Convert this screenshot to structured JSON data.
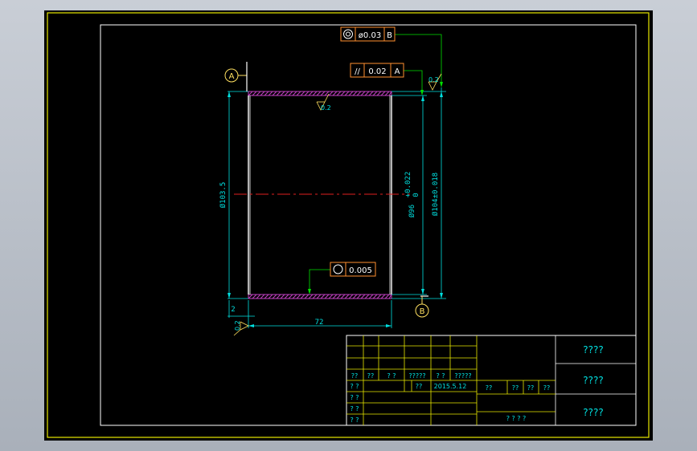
{
  "colors": {
    "frame_outer": "#e8e800",
    "frame_inner": "#ffffff",
    "dimension": "#00e0e0",
    "leader": "#00e000",
    "datum": "#ffe060",
    "outline": "#ffffff",
    "hatch": "#c040c0",
    "centerline": "#e02020",
    "tolerance_frame": "#ff9030"
  },
  "tolerances": {
    "concentricity": {
      "symbol": "◎",
      "value": "ø0.03",
      "datum": "B"
    },
    "parallelism": {
      "symbol": "//",
      "value": "0.02",
      "datum": "A"
    },
    "cylindricity": {
      "symbol": "○",
      "value": "0.005"
    }
  },
  "datums": {
    "a": "A",
    "b": "B"
  },
  "dimensions": {
    "outer_dia": "Ø103.5",
    "inner_dia_base": "Ø96",
    "inner_dia_upper": "+0.022",
    "inner_dia_lower": "0",
    "overall_dia": "Ø104±0.018",
    "length": "72",
    "chamfer": "2"
  },
  "roughness": {
    "top": "0.2",
    "right": "0.2",
    "bottom_left": "0.2"
  },
  "title_block": {
    "row_headers": [
      "??",
      "??",
      "? ?",
      "?????",
      "? ?",
      "?????"
    ],
    "row_design": [
      "? ?",
      "??",
      "2015.5.12"
    ],
    "row_check": "? ?",
    "row_process": "? ?",
    "row_approve": "? ?",
    "mid_cells": [
      "??",
      "??",
      "??",
      "??"
    ],
    "mid_bottom": "? ? ? ?",
    "right_cells": [
      "????",
      "????",
      "????"
    ]
  }
}
